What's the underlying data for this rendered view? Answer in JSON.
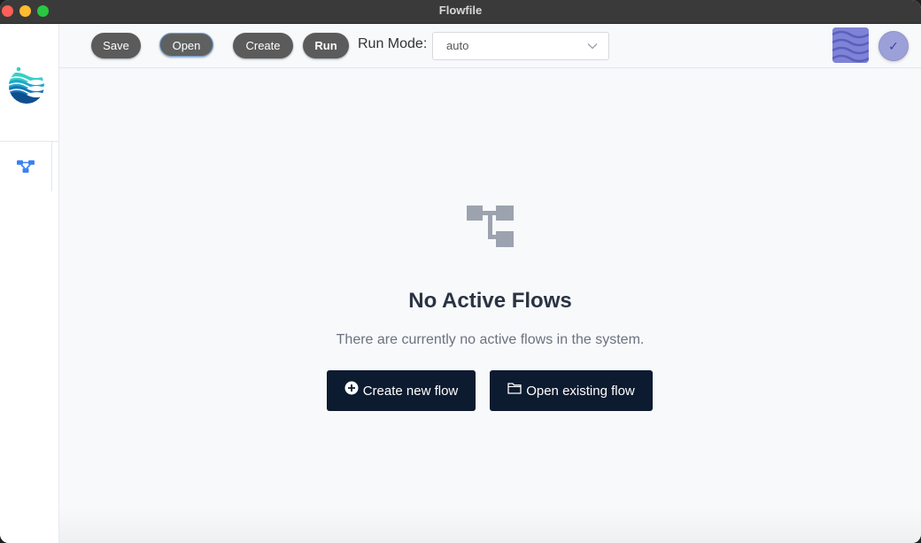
{
  "window": {
    "title": "Flowfile"
  },
  "toolbar": {
    "save_label": "Save",
    "open_label": "Open",
    "create_label": "Create",
    "run_label": "Run",
    "run_mode_label": "Run Mode:",
    "run_mode_value": "auto"
  },
  "sidebar": {
    "items": [
      {
        "icon": "flow-icon"
      }
    ]
  },
  "main": {
    "empty_title": "No Active Flows",
    "empty_description": "There are currently no active flows in the system.",
    "create_new_label": "Create new flow",
    "open_existing_label": "Open existing flow"
  },
  "user": {
    "status_glyph": "✓"
  },
  "colors": {
    "titlebar": "#3a3a3a",
    "toolbar_button": "#5b5b5b",
    "primary_button": "#0d1b30",
    "sidebar_icon": "#3b82f6",
    "avatar": "#9ca0d9"
  }
}
